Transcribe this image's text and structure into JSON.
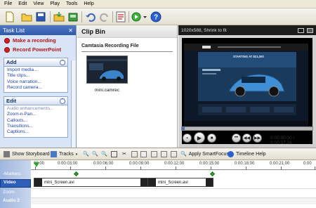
{
  "menu": [
    "File",
    "Edit",
    "View",
    "Play",
    "Tools",
    "Help"
  ],
  "toolbar": {
    "icons": [
      "new-project-icon",
      "save-icon",
      "save-as-icon",
      "import-icon",
      "export-icon",
      "undo-icon",
      "redo-icon",
      "checklist-icon",
      "produce-icon",
      "help-icon"
    ]
  },
  "tasklist": {
    "title": "Task List",
    "close": "✕",
    "actions": [
      "Make a recording",
      "Record PowerPoint"
    ],
    "groups": [
      {
        "title": "Add",
        "links": [
          "Import media...",
          "Title clips...",
          "Voice narration...",
          "Record camera..."
        ]
      },
      {
        "title": "Edit",
        "links": [
          "Audio enhancements...",
          "Zoom-n-Pan...",
          "Callouts...",
          "Transitions...",
          "Captions..."
        ]
      }
    ]
  },
  "clipbin": {
    "title": "Clip Bin",
    "section": "Camtasia Recording File",
    "clip_name": "mini.camrec"
  },
  "preview": {
    "resolution": "1020x588, Shrink to fit",
    "timecode": "0:00:00:00 / 0:00:37:26",
    "site_text": "STARTING AT $21,000",
    "progress": 0.02
  },
  "timeline_toolbar": {
    "storyboard": "Show Storyboard",
    "tracks": "Tracks",
    "smartfocus": "Apply SmartFocus",
    "help": "Timeline Help"
  },
  "timeline": {
    "labels": [
      "Markers",
      "Video",
      "Zoom",
      "Audio 2"
    ],
    "ruler": [
      "00:00",
      "0:00:03;00",
      "0:00:06;00",
      "0:00:09;00",
      "0:00:12;00",
      "0:00:15;00",
      "0:00:18;00",
      "0:00:21;00",
      "0:00"
    ],
    "clips": [
      "mini_Screen.avi",
      "mini_Screen.avi"
    ]
  }
}
